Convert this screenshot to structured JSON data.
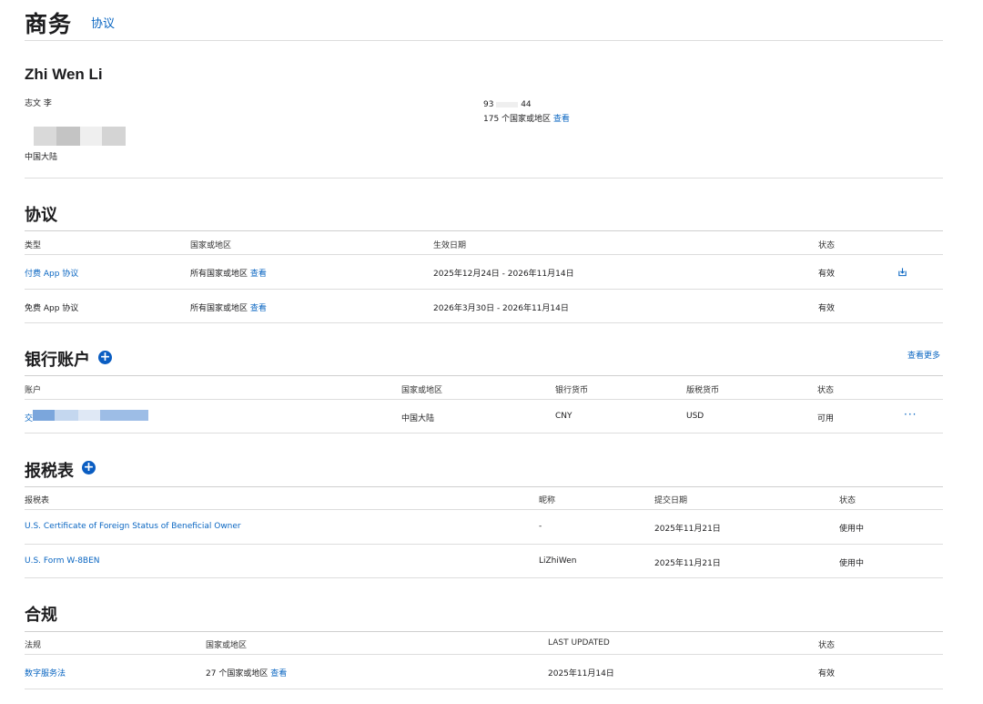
{
  "header": {
    "title": "商务",
    "tab": "协议"
  },
  "profile": {
    "name": "Zhi Wen Li",
    "local_name": "志文 李",
    "region": "中国大陆",
    "id_prefix": "93",
    "id_suffix": "44",
    "countries_text": "175 个国家或地区",
    "countries_link": "查看"
  },
  "agreements": {
    "title": "协议",
    "columns": [
      "类型",
      "国家或地区",
      "生效日期",
      "状态"
    ],
    "rows": [
      {
        "type": "付费 App 协议",
        "type_is_link": true,
        "region": "所有国家或地区",
        "region_link": "查看",
        "dates": "2025年12月24日 - 2026年11月14日",
        "status": "有效"
      },
      {
        "type": "免费 App 协议",
        "type_is_link": false,
        "region": "所有国家或地区",
        "region_link": "查看",
        "dates": "2026年3月30日 - 2026年11月14日",
        "status": "有效"
      }
    ]
  },
  "bank": {
    "title": "银行账户",
    "see_more": "查看更多",
    "columns": [
      "账户",
      "国家或地区",
      "银行货币",
      "版税货币",
      "状态"
    ],
    "rows": [
      {
        "account_prefix": "交",
        "region": "中国大陆",
        "bank_currency": "CNY",
        "royalty_currency": "USD",
        "status": "可用",
        "more": "···"
      }
    ]
  },
  "tax": {
    "title": "报税表",
    "columns": [
      "报税表",
      "昵称",
      "提交日期",
      "状态"
    ],
    "rows": [
      {
        "form": "U.S. Certificate of Foreign Status of Beneficial Owner",
        "nickname": "-",
        "date": "2025年11月21日",
        "status": "使用中"
      },
      {
        "form": "U.S. Form W-8BEN",
        "nickname": "LiZhiWen",
        "date": "2025年11月21日",
        "status": "使用中"
      }
    ]
  },
  "compliance": {
    "title": "合规",
    "columns": [
      "法规",
      "国家或地区",
      "LAST UPDATED",
      "状态"
    ],
    "rows": [
      {
        "regulation": "数字服务法",
        "region": "27 个国家或地区",
        "region_link": "查看",
        "updated": "2025年11月14日",
        "status": "有效"
      }
    ]
  },
  "colors": {
    "link": "#0a66c2",
    "accent": "#0a5dc2",
    "divider": "#dddddd"
  }
}
